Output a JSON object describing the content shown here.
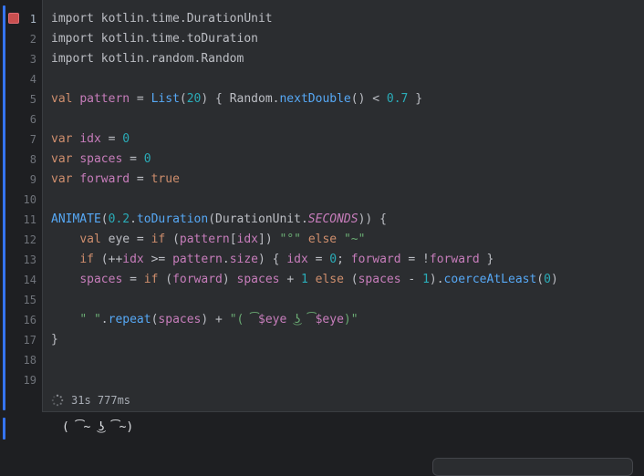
{
  "editor": {
    "line_numbers": [
      "1",
      "2",
      "3",
      "4",
      "5",
      "6",
      "7",
      "8",
      "9",
      "10",
      "11",
      "12",
      "13",
      "14",
      "15",
      "16",
      "17",
      "18",
      "19"
    ],
    "lines": {
      "l1": [
        "import kotlin.time.DurationUnit"
      ],
      "l2": [
        "import kotlin.time.toDuration"
      ],
      "l3": [
        "import kotlin.random.Random"
      ],
      "l5": [
        "val",
        " ",
        "pattern",
        " = ",
        "List",
        "(",
        "20",
        ") { Random.",
        "nextDouble",
        "() < ",
        "0.7",
        " }"
      ],
      "l7": [
        "var",
        " ",
        "idx",
        " = ",
        "0"
      ],
      "l8": [
        "var",
        " ",
        "spaces",
        " = ",
        "0"
      ],
      "l9": [
        "var",
        " ",
        "forward",
        " = ",
        "true"
      ],
      "l11": [
        "ANIMATE",
        "(",
        "0.2",
        ".",
        "toDuration",
        "(DurationUnit.",
        "SECONDS",
        ")) {"
      ],
      "l12": [
        "    ",
        "val",
        " eye = ",
        "if",
        " (",
        "pattern",
        "[",
        "idx",
        "]) ",
        "\"°\"",
        " ",
        "else",
        " ",
        "\"~\""
      ],
      "l13": [
        "    ",
        "if",
        " (++",
        "idx",
        " >= ",
        "pattern",
        ".",
        "size",
        ") { ",
        "idx",
        " = ",
        "0",
        "; ",
        "forward",
        " = !",
        "forward",
        " }"
      ],
      "l14": [
        "    ",
        "spaces",
        " = ",
        "if",
        " (",
        "forward",
        ") ",
        "spaces",
        " + ",
        "1",
        " ",
        "else",
        " (",
        "spaces",
        " - ",
        "1",
        ").",
        "coerceAtLeast",
        "(",
        "0",
        ")"
      ],
      "l16": [
        "    ",
        "\" \"",
        ".",
        "repeat",
        "(",
        "spaces",
        ") + ",
        "\"( ͡",
        "$eye",
        " ͜ʖ ͡",
        "$eye",
        ")\""
      ],
      "l17": [
        "}"
      ]
    }
  },
  "status": {
    "elapsed": "31s 777ms"
  },
  "output": {
    "text": "( ͡~ ͜ʖ ͡~)"
  },
  "colors": {
    "keyword": "#cf8e6d",
    "property": "#c77dbb",
    "number": "#2aacb8",
    "function": "#56a8f5",
    "string": "#6aab73",
    "accent": "#3574f0",
    "stop": "#c94f4f"
  }
}
